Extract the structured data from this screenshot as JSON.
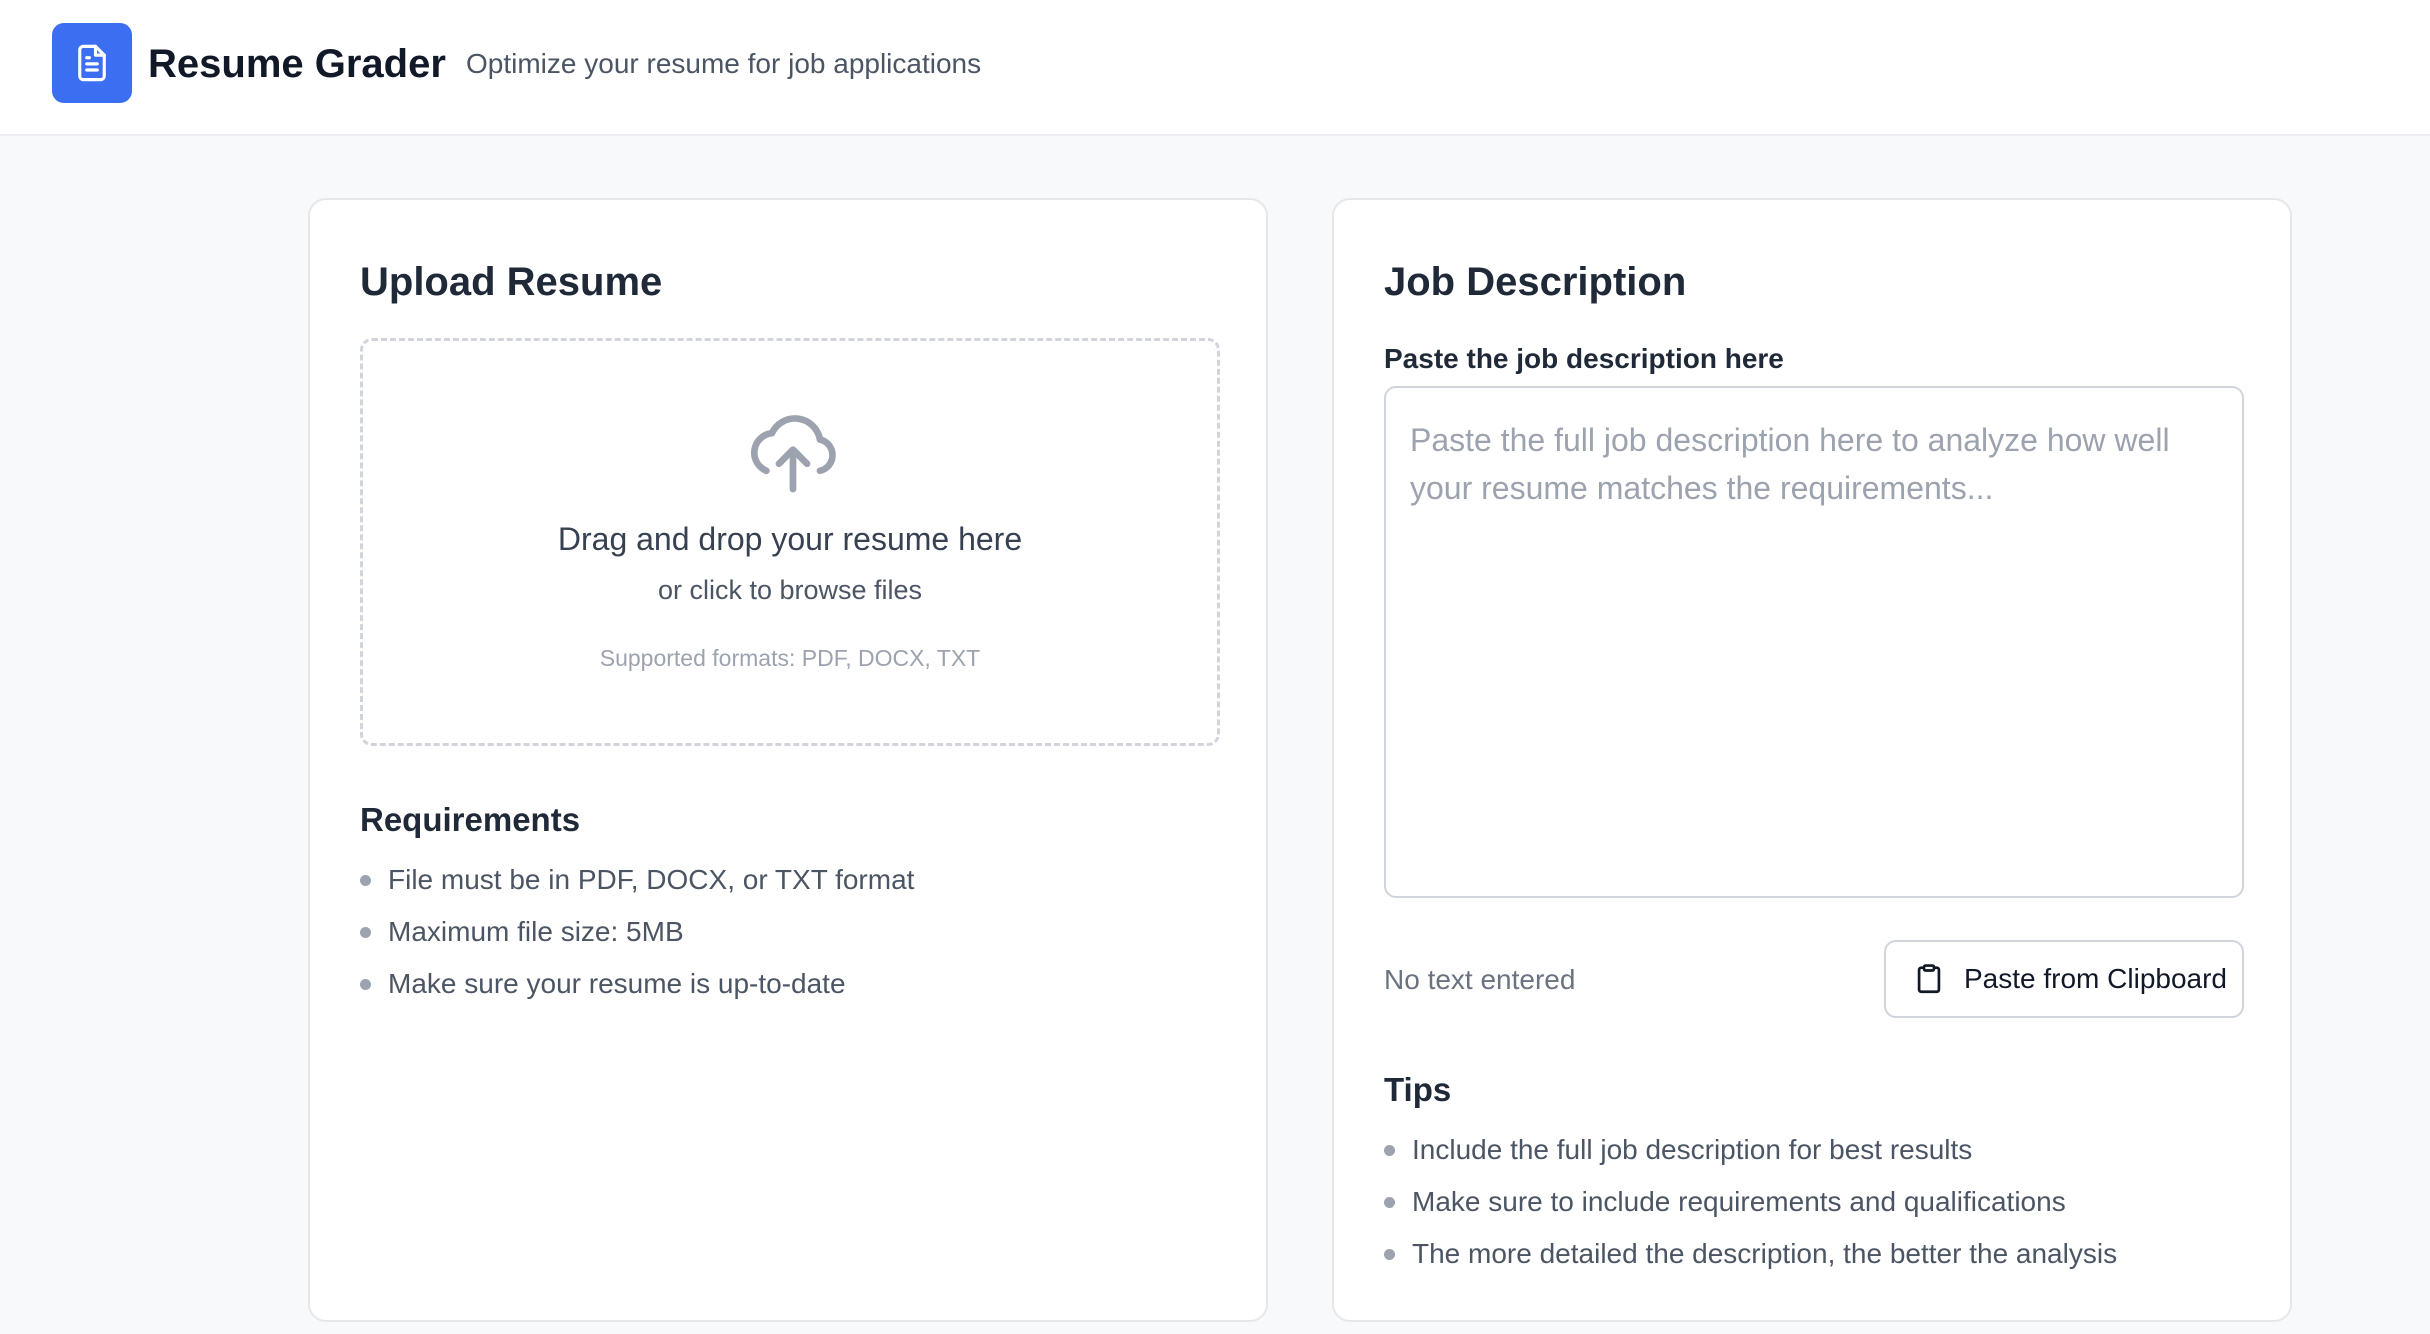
{
  "header": {
    "app_title": "Resume Grader",
    "app_subtitle": "Optimize your resume for job applications",
    "logo_icon": "document-icon",
    "brand_color": "#3b6ef0"
  },
  "upload_card": {
    "title": "Upload Resume",
    "dropzone": {
      "icon": "cloud-upload-icon",
      "main_text": "Drag and drop your resume here",
      "sub_text": "or click to browse files",
      "formats_text": "Supported formats: PDF, DOCX, TXT"
    },
    "requirements": {
      "heading": "Requirements",
      "items": [
        "File must be in PDF, DOCX, or TXT format",
        "Maximum file size: 5MB",
        "Make sure your resume is up-to-date"
      ]
    }
  },
  "job_card": {
    "title": "Job Description",
    "field_label": "Paste the job description here",
    "textarea": {
      "value": "",
      "placeholder": "Paste the full job description here to analyze how well your resume matches the requirements..."
    },
    "status_text": "No text entered",
    "paste_button": {
      "icon": "clipboard-icon",
      "label": "Paste from Clipboard"
    },
    "tips": {
      "heading": "Tips",
      "items": [
        "Include the full job description for best results",
        "Make sure to include requirements and qualifications",
        "The more detailed the description, the better the analysis"
      ]
    }
  }
}
